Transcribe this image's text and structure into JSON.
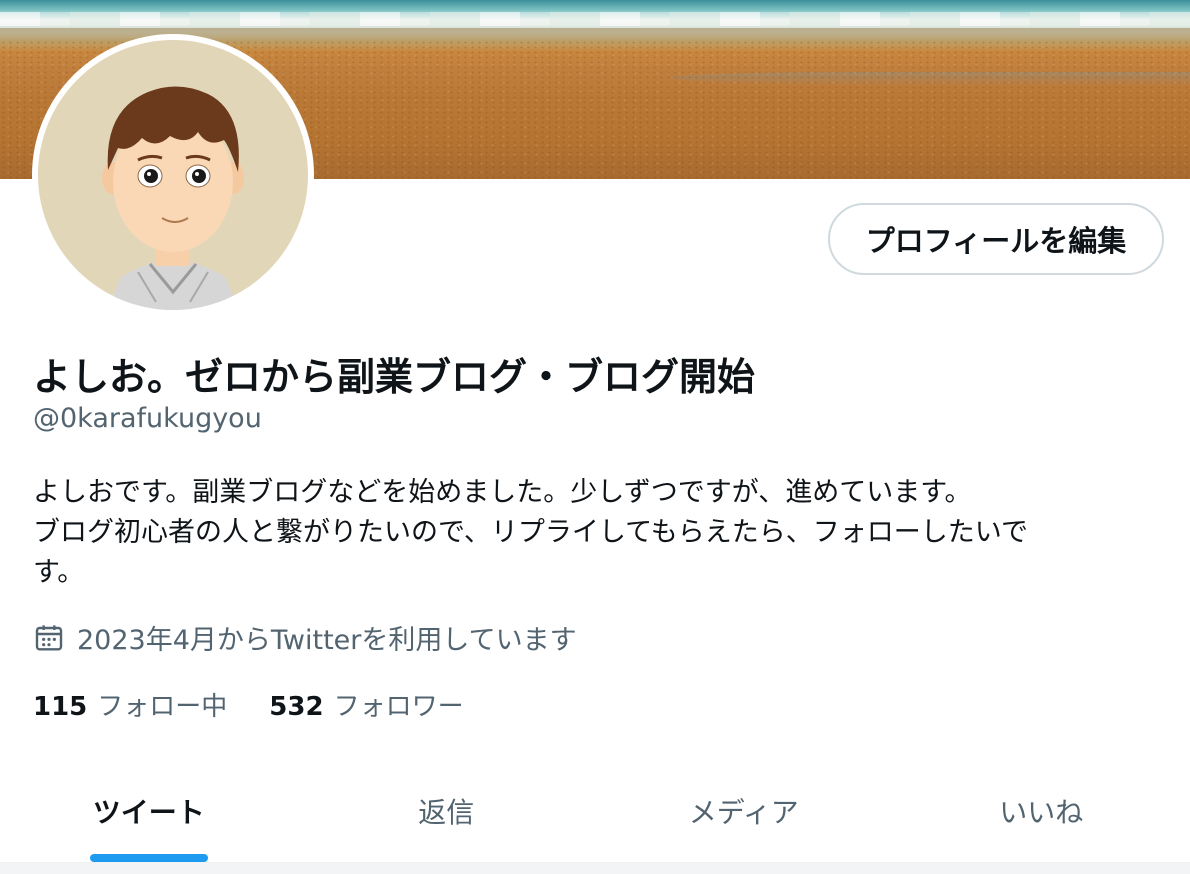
{
  "profile": {
    "edit_button": "プロフィールを編集",
    "display_name": "よしお。ゼロから副業ブログ・ブログ開始",
    "handle": "@0karafukugyou",
    "bio_lines": [
      "よしおです。副業ブログなどを始めました。少しずつですが、進めています。",
      "ブログ初心者の人と繋がりたいので、リプライしてもらえたら、フォローしたいで",
      "す。"
    ],
    "joined": "2023年4月からTwitterを利用しています",
    "joined_icon": "calendar-icon",
    "following_count": "115",
    "following_label": "フォロー中",
    "followers_count": "532",
    "followers_label": "フォロワー"
  },
  "tabs": [
    {
      "label": "ツイート",
      "active": true
    },
    {
      "label": "返信",
      "active": false
    },
    {
      "label": "メディア",
      "active": false
    },
    {
      "label": "いいね",
      "active": false
    }
  ],
  "colors": {
    "accent": "#1d9bf0",
    "text_primary": "#0f1419",
    "text_secondary": "#536471",
    "border": "#cfd9de"
  }
}
